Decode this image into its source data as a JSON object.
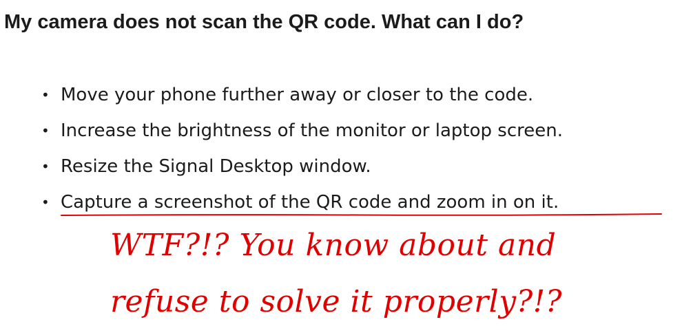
{
  "faq": {
    "title": "My camera does not scan the QR code. What can I do?",
    "bullet": "•",
    "items": [
      "Move your phone further away or closer to the code.",
      "Increase the brightness of the monitor or laptop screen.",
      "Resize the Signal Desktop window.",
      "Capture a screenshot of the QR code and zoom in on it."
    ]
  },
  "annotation": {
    "color": "#e00000",
    "line1": "WTF?!? You know about and",
    "line2": "refuse to solve it properly?!?"
  }
}
